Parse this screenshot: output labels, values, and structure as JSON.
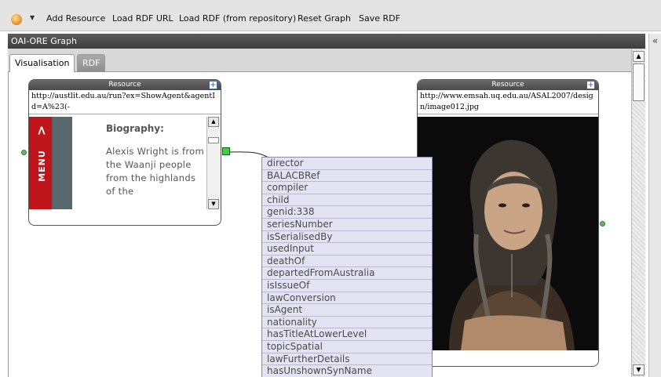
{
  "toolbar": {
    "buttons": [
      "Add Resource",
      "Load RDF URL",
      "Load RDF (from repository)",
      "Reset Graph",
      "Save RDF"
    ]
  },
  "panel": {
    "title": "OAI-ORE Graph",
    "collapse_glyph": "«",
    "tabs": [
      "Visualisation",
      "RDF"
    ]
  },
  "nodes": {
    "left": {
      "header": "Resource",
      "url": "http://austlit.edu.au/run?ex=ShowAgent&agentId=A%23(-",
      "menu_label": "MENU",
      "bio_heading": "Biography:",
      "bio_text": "Alexis Wright is from the Waanji people from the highlands of the"
    },
    "right": {
      "header": "Resource",
      "url": "http://www.emsah.uq.edu.au/ASAL2007/design/image012.jpg"
    }
  },
  "relationship_menu": [
    "director",
    "BALACBRef",
    "compiler",
    "child",
    "genid:338",
    "seriesNumber",
    "isSerialisedBy",
    "usedInput",
    "deathOf",
    "departedFromAustralia",
    "isIssueOf",
    "lawConversion",
    "isAgent",
    "nationality",
    "hasTitleAtLowerLevel",
    "topicSpatial",
    "lawFurtherDetails",
    "hasUnshownSynName"
  ],
  "icons": {
    "logo": "app-logo-icon",
    "expand": "expand-plus-icon",
    "scroll_up": "scroll-up-arrow-icon",
    "scroll_down": "scroll-down-arrow-icon"
  },
  "colors": {
    "panel_header": "#4a4a4a",
    "menu_bg": "#e3e3f3",
    "menu_red": "#c0141b",
    "connector_green": "#3cd33c"
  }
}
